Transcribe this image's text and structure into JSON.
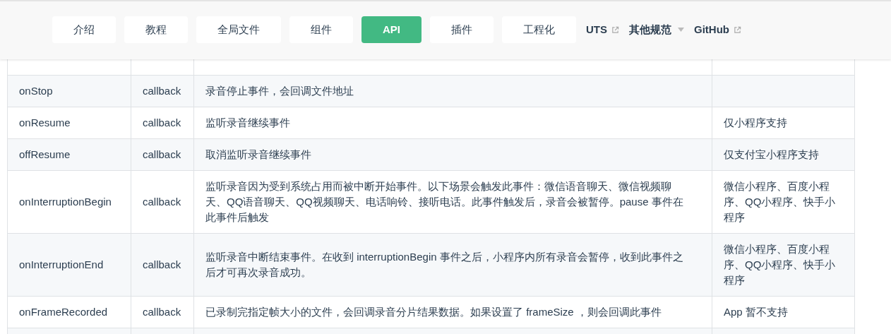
{
  "nav": {
    "items": [
      {
        "label": "介绍",
        "kind": "button",
        "selected": false
      },
      {
        "label": "教程",
        "kind": "button",
        "selected": false
      },
      {
        "label": "全局文件",
        "kind": "button",
        "selected": false
      },
      {
        "label": "组件",
        "kind": "button",
        "selected": false
      },
      {
        "label": "API",
        "kind": "button",
        "selected": true
      },
      {
        "label": "插件",
        "kind": "button",
        "selected": false
      },
      {
        "label": "工程化",
        "kind": "button",
        "selected": false
      },
      {
        "label": "UTS",
        "kind": "external"
      },
      {
        "label": "其他规范",
        "kind": "dropdown"
      },
      {
        "label": "GitHub",
        "kind": "external"
      }
    ]
  },
  "table": {
    "rows": [
      {
        "name": "onStop",
        "type": "callback",
        "description": "录音停止事件，会回调文件地址"
      },
      {
        "name": "onResume",
        "type": "callback",
        "description": "监听录音继续事件",
        "support": "仅小程序支持"
      },
      {
        "name": "offResume",
        "type": "callback",
        "description": "取消监听录音继续事件",
        "support": "仅支付宝小程序支持"
      },
      {
        "name": "onInterruptionBegin",
        "type": "callback",
        "description": "监听录音因为受到系统占用而被中断开始事件。以下场景会触发此事件：微信语音聊天、微信视频聊天、QQ语音聊天、QQ视频聊天、电话响铃、接听电话。此事件触发后，录音会被暂停。pause 事件在此事件后触发",
        "support": "微信小程序、百度小程序、QQ小程序、快手小程序"
      },
      {
        "name": "onInterruptionEnd",
        "type": "callback",
        "description": "监听录音中断结束事件。在收到 interruptionBegin 事件之后，小程序内所有录音会暂停，收到此事件之后才可再次录音成功。",
        "support": "微信小程序、百度小程序、QQ小程序、快手小程序"
      },
      {
        "name": "onFrameRecorded",
        "type": "callback",
        "description": "已录制完指定帧大小的文件，会回调录音分片结果数据。如果设置了 frameSize ，则会回调此事件",
        "support": "App 暂不支持"
      }
    ]
  }
}
